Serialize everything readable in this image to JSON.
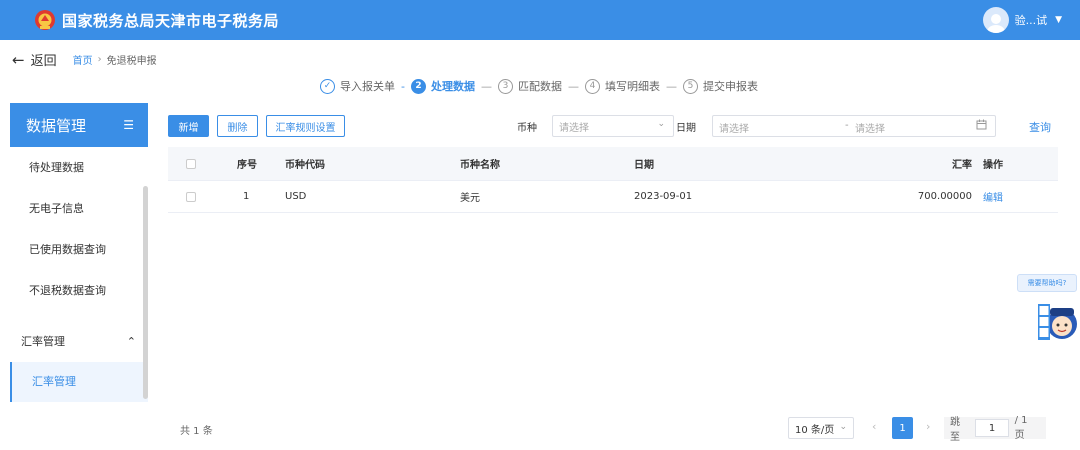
{
  "header": {
    "title": "国家税务总局天津市电子税务局",
    "user_name": "验...试",
    "accent": "#3a8ee6"
  },
  "nav": {
    "back_label": "返回",
    "breadcrumb": [
      "首页",
      "免退税申报"
    ]
  },
  "steps": [
    {
      "num": "✓",
      "label": "导入报关单",
      "state": "done"
    },
    {
      "num": "2",
      "label": "处理数据",
      "state": "active"
    },
    {
      "num": "3",
      "label": "匹配数据",
      "state": "todo"
    },
    {
      "num": "4",
      "label": "填写明细表",
      "state": "todo"
    },
    {
      "num": "5",
      "label": "提交申报表",
      "state": "todo"
    }
  ],
  "sidebar": {
    "title": "数据管理",
    "items": [
      "待处理数据",
      "无电子信息",
      "已使用数据查询",
      "不退税数据查询"
    ],
    "group_label": "汇率管理",
    "sub_item": "汇率管理"
  },
  "toolbar": {
    "add_label": "新增",
    "delete_label": "删除",
    "rate_rule_label": "汇率规则设置",
    "currency_label": "币种",
    "currency_placeholder": "请选择",
    "date_label": "日期",
    "date_start_placeholder": "请选择",
    "date_sep": "-",
    "date_end_placeholder": "请选择",
    "query_label": "查询"
  },
  "table": {
    "headers": {
      "seq": "序号",
      "code": "币种代码",
      "name": "币种名称",
      "date": "日期",
      "rate": "汇率",
      "action": "操作"
    },
    "rows": [
      {
        "seq": "1",
        "code": "USD",
        "name": "美元",
        "date": "2023-09-01",
        "rate": "700.00000",
        "action": "编辑"
      }
    ]
  },
  "footer": {
    "total": "共 1 条",
    "page_size": "10 条/页",
    "current_page": "1",
    "jump_label": "跳至",
    "jump_value": "1",
    "total_pages": "/ 1 页"
  },
  "help": {
    "bubble": "需要帮助吗?"
  }
}
